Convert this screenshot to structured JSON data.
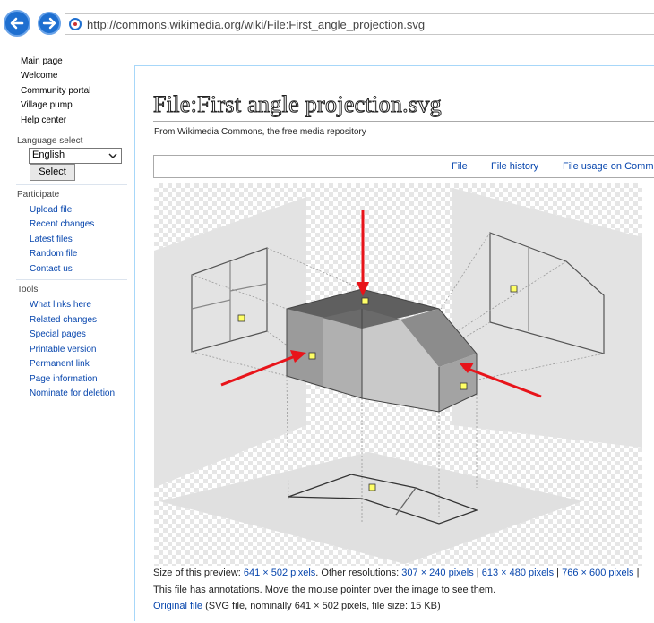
{
  "browser": {
    "url": "http://commons.wikimedia.org/wiki/File:First_angle_projection.svg",
    "back_icon": "back-arrow-icon",
    "forward_icon": "forward-arrow-icon"
  },
  "sidebar": {
    "main": [
      "Main page",
      "Welcome",
      "Community portal",
      "Village pump",
      "Help center"
    ],
    "language": {
      "heading": "Language select",
      "selected": "English",
      "button": "Select"
    },
    "participate": {
      "heading": "Participate",
      "items": [
        "Upload file",
        "Recent changes",
        "Latest files",
        "Random file",
        "Contact us"
      ]
    },
    "tools": {
      "heading": "Tools",
      "items": [
        "What links here",
        "Related changes",
        "Special pages",
        "Printable version",
        "Permanent link",
        "Page information",
        "Nominate for deletion"
      ]
    }
  },
  "page": {
    "title": "File:First angle projection.svg",
    "subtitle": "From Wikimedia Commons, the free media repository",
    "tabs": [
      "File",
      "File history",
      "File usage on Comm"
    ]
  },
  "info": {
    "size_label": "Size of this preview: ",
    "size_value": "641 × 502 pixels",
    "other_label": ". Other resolutions: ",
    "res1": "307 × 240 pixels",
    "res2": "613 × 480 pixels",
    "res3": "766 × 600 pixels",
    "sep": " | ",
    "annotations": "This file has annotations. Move the mouse pointer over the image to see them.",
    "original_link": "Original file",
    "original_details": " (SVG file, nominally 641 × 502 pixels, file size: 15 KB)"
  },
  "colors": {
    "link": "#0645ad",
    "arrow": "#e8141a",
    "annotation": "#ffff66"
  }
}
